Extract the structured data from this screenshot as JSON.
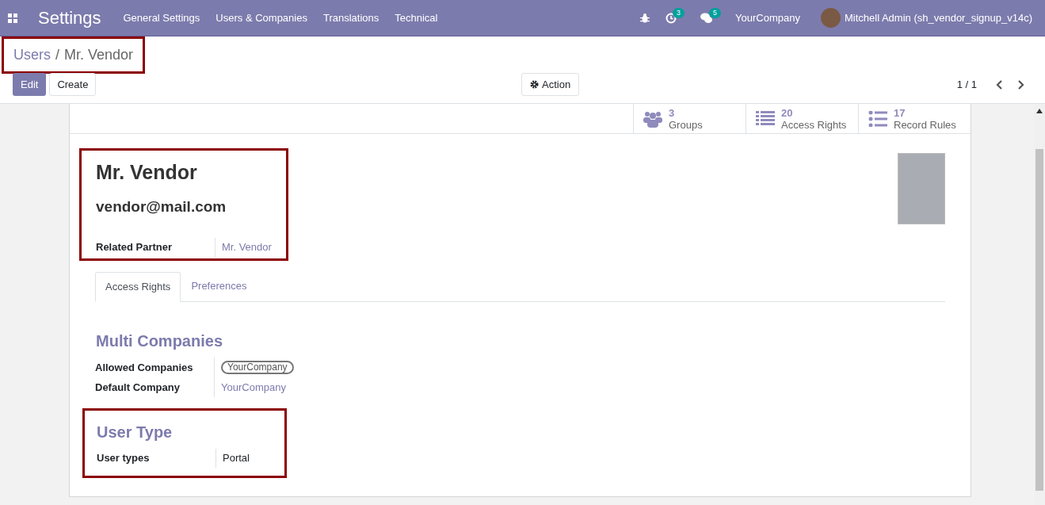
{
  "navbar": {
    "app_title": "Settings",
    "menu": [
      "General Settings",
      "Users & Companies",
      "Translations",
      "Technical"
    ],
    "activity_count": "3",
    "message_count": "5",
    "company": "YourCompany",
    "user": "Mitchell Admin (sh_vendor_signup_v14c)"
  },
  "breadcrumb": {
    "parent": "Users",
    "separator": "/",
    "current": "Mr. Vendor"
  },
  "buttons": {
    "edit": "Edit",
    "create": "Create",
    "action": "Action"
  },
  "pager": "1 / 1",
  "smart_buttons": [
    {
      "kind": "groups",
      "count": "3",
      "label": "Groups"
    },
    {
      "kind": "list",
      "count": "20",
      "label": "Access Rights"
    },
    {
      "kind": "bullets",
      "count": "17",
      "label": "Record Rules"
    }
  ],
  "record": {
    "name": "Mr. Vendor",
    "login": "vendor@mail.com",
    "related_partner_label": "Related Partner",
    "related_partner": "Mr. Vendor"
  },
  "tabs": [
    {
      "label": "Access Rights",
      "selected": true
    },
    {
      "label": "Preferences",
      "selected": false
    }
  ],
  "multi_companies": {
    "title": "Multi Companies",
    "allowed_label": "Allowed Companies",
    "allowed_tags": [
      "YourCompany"
    ],
    "default_label": "Default Company",
    "default_value": "YourCompany"
  },
  "user_type": {
    "title": "User Type",
    "label": "User types",
    "value": "Portal"
  }
}
